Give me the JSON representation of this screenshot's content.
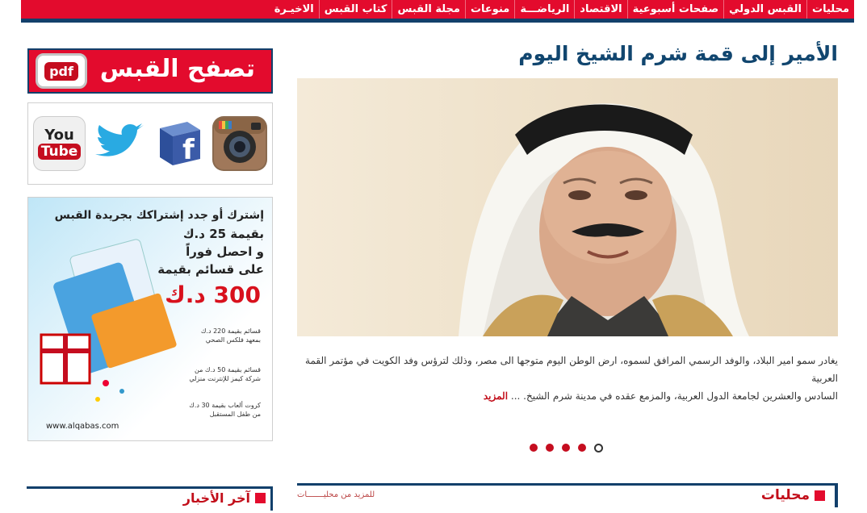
{
  "nav": {
    "items": [
      "محليات",
      "القبس الدولي",
      "صفحات أسبوعية",
      "الاقتصاد",
      "الرياضـــة",
      "منوعات",
      "مجلة القبس",
      "كتاب القبس",
      "الاخيـرة"
    ]
  },
  "main": {
    "headline": "الأمير إلى قمة شرم الشيخ اليوم",
    "article_line1": "يغادر سمو امير البلاد، والوفد الرسمي المرافق لسموه، ارض الوطن اليوم متوجها الى مصر، وذلك لترؤس وفد الكويت في مؤتمر القمة العربية",
    "article_line2": "السادس والعشرين لجامعة الدول العربية، والمزمع عقده في مدينة شرم الشيخ.  ...",
    "more_label": "المزيد",
    "slider_dots": 5,
    "section_title": "محليات",
    "section_more": "للمزيد من محليـــــــات"
  },
  "sidebar": {
    "pdf_label": "تصفح القبس",
    "pdf_badge": "pdf",
    "social": [
      "instagram-icon",
      "facebook-icon",
      "twitter-icon",
      "youtube-icon"
    ],
    "youtube_top": "You",
    "youtube_bottom": "Tube",
    "ad": {
      "line1": "إشترك أو جدد إشتراكك بجريدة القبس",
      "line2": "بقيمة 25 د.ك",
      "line3": "و احصل فوراً",
      "line4": "على قسائم بقيمة",
      "price": "300 د.ك",
      "item1": "قسائم بقيمة 220 د.ك بمعهد فلكس الصحي",
      "item2": "قسائم بقيمة 50 د.ك من شركة كيمز للإنترنت منزلي",
      "item3": "كروت ألعاب بقيمة 30 د.ك من طفل المستقبل",
      "url": "www.alqabas.com"
    },
    "latest_title": "آخر الأخبار"
  },
  "colors": {
    "brand_red": "#e30b2d",
    "brand_navy": "#12406b",
    "headline_blue": "#11466f"
  }
}
